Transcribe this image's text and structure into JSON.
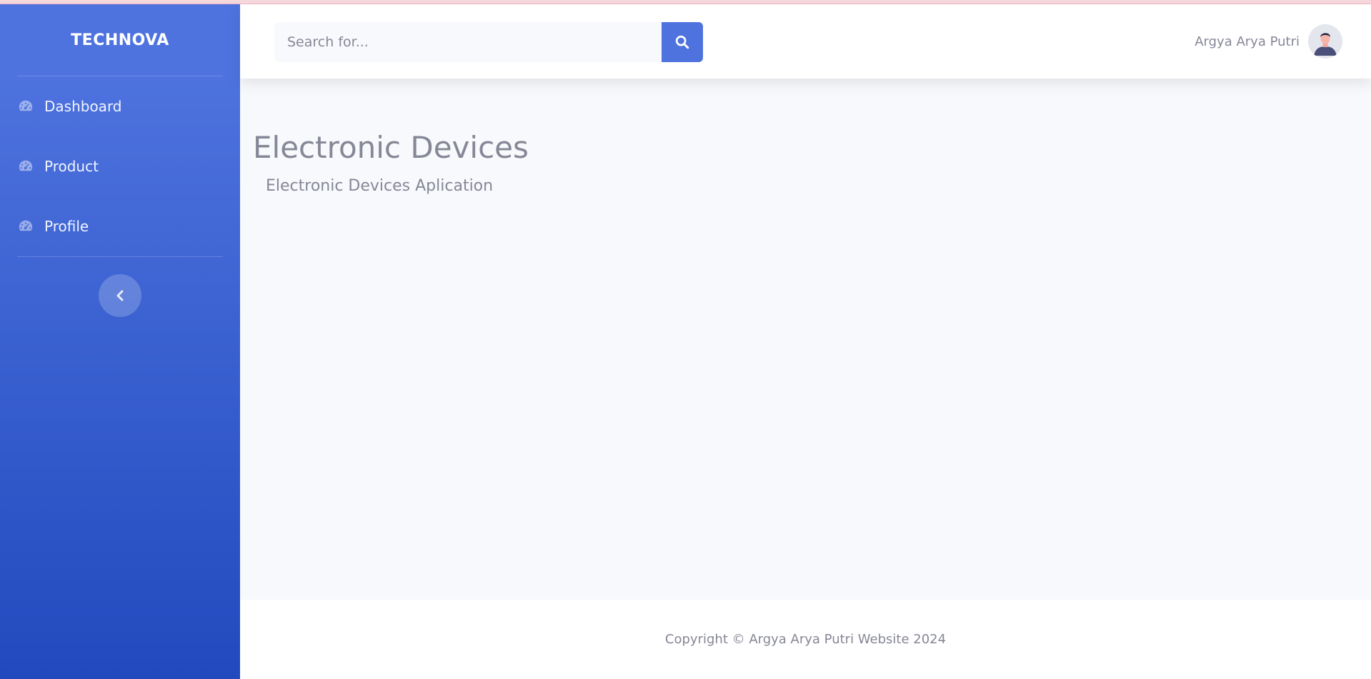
{
  "sidebar": {
    "brand": "TECHNOVA",
    "items": [
      {
        "label": "Dashboard",
        "icon": "tachometer-icon"
      },
      {
        "label": "Product",
        "icon": "tachometer-icon"
      },
      {
        "label": "Profile",
        "icon": "tachometer-icon"
      }
    ],
    "toggle_icon": "chevron-left-icon"
  },
  "topbar": {
    "search": {
      "placeholder": "Search for...",
      "value": "",
      "button_icon": "search-icon"
    },
    "user": {
      "name": "Argya Arya Putri",
      "avatar_icon": "user-avatar"
    }
  },
  "main": {
    "title": "Electronic Devices",
    "subtitle": "Electronic Devices Aplication"
  },
  "footer": {
    "copyright": "Copyright © Argya Arya Putri Website 2024"
  },
  "colors": {
    "primary": "#4e73df",
    "sidebar_gradient_end": "#224abe",
    "text_muted": "#858796",
    "background": "#f8f9fc"
  }
}
